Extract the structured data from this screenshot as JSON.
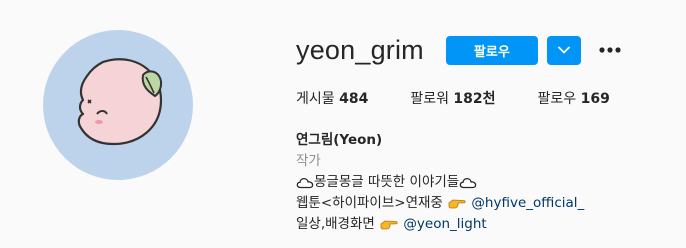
{
  "profile": {
    "username": "yeon_grim",
    "follow_label": "팔로우",
    "stats": [
      {
        "label": "게시물",
        "value": "484"
      },
      {
        "label": "팔로워",
        "value": "182천"
      },
      {
        "label": "팔로우",
        "value": "169"
      }
    ],
    "name": "연그림(Yeon)",
    "category": "작가",
    "bio": {
      "line1": "몽글몽글 따뜻한 이야기들",
      "line2_text": "웹툰<하이파이브>연재중 ",
      "line2_mention": "@hyfive_official_",
      "line3_text": "일상,배경화면 ",
      "line3_mention": "@yeon_light"
    }
  },
  "colors": {
    "accent": "#0095f6",
    "avatar_bg": "#bdd3ec",
    "avatar_face": "#f5d3d6",
    "leaf": "#bcd6a6",
    "mention": "#00376b",
    "muted": "#8e8e8e"
  },
  "icons": {
    "dropdown": "chevron-down-icon",
    "more": "more-dots-icon",
    "cloud": "cloud-icon",
    "pointing": "pointing-hand-icon"
  }
}
